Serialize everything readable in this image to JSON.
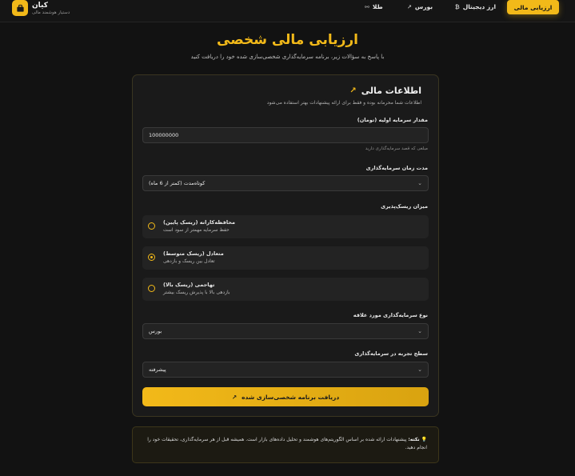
{
  "header": {
    "brand_name": "کیان",
    "brand_subtitle": "دستیار هوشمند مالی",
    "nav": {
      "active": "ارزیابی مالی",
      "crypto": "ارز دیجیتال",
      "crypto_icon": "bitcoin-icon",
      "stocks": "بورس",
      "stocks_icon": "trend-icon",
      "gold": "طلا",
      "gold_icon": "coins-icon"
    }
  },
  "page": {
    "title": "ارزیابی مالی شخصی",
    "subtitle": "با پاسخ به سؤالات زیر، برنامه سرمایه‌گذاری شخصی‌سازی شده خود را دریافت کنید"
  },
  "card": {
    "title": "اطلاعات مالی",
    "subtitle": "اطلاعات شما محرمانه بوده و فقط برای ارائه پیشنهادات بهتر استفاده می‌شود",
    "capital": {
      "label": "مقدار سرمایه اولیه (تومان)",
      "value": "100000000",
      "hint": "مبلغی که قصد سرمایه‌گذاری دارید"
    },
    "duration": {
      "label": "مدت زمان سرمایه‌گذاری",
      "value": "کوتاه‌مدت (کمتر از 6 ماه)"
    },
    "risk": {
      "label": "میزان ریسک‌پذیری",
      "options": [
        {
          "title": "محافظه‌کارانه (ریسک پایین)",
          "desc": "حفظ سرمایه مهمتر از سود است",
          "checked": false
        },
        {
          "title": "متعادل (ریسک متوسط)",
          "desc": "تعادل بین ریسک و بازدهی",
          "checked": true
        },
        {
          "title": "تهاجمی (ریسک بالا)",
          "desc": "بازدهی بالا با پذیرش ریسک بیشتر",
          "checked": false
        }
      ]
    },
    "investment_type": {
      "label": "نوع سرمایه‌گذاری مورد علاقه",
      "value": "بورس"
    },
    "experience": {
      "label": "سطح تجربه در سرمایه‌گذاری",
      "value": "پیشرفته"
    },
    "submit_label": "دریافت برنامه شخصی‌سازی شده"
  },
  "note": {
    "prefix": "نکته:",
    "text": "پیشنهادات ارائه شده بر اساس الگوریتم‌های هوشمند و تحلیل داده‌های بازار است. همیشه قبل از هر سرمایه‌گذاری، تحقیقات خود را انجام دهید."
  },
  "colors": {
    "accent": "#f2b919",
    "background": "#121212",
    "card": "#1a1a1a"
  }
}
